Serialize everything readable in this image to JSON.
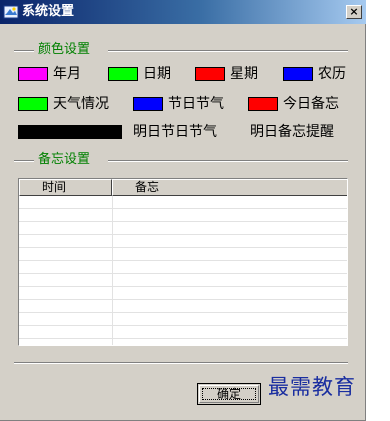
{
  "window": {
    "title": "系统设置",
    "close_glyph": "×"
  },
  "color_section": {
    "title": "颜色设置",
    "items": [
      {
        "label": "年月",
        "color": "#ff00ff"
      },
      {
        "label": "日期",
        "color": "#00ff00"
      },
      {
        "label": "星期",
        "color": "#ff0000"
      },
      {
        "label": "农历",
        "color": "#0000ff"
      },
      {
        "label": "天气情况",
        "color": "#00ff00"
      },
      {
        "label": "节日节气",
        "color": "#0000ff"
      },
      {
        "label": "今日备忘",
        "color": "#ff0000"
      },
      {
        "label": "明日节日节气",
        "color": "#000000"
      },
      {
        "label": "明日备忘提醒",
        "color": "#000000"
      }
    ]
  },
  "memo_section": {
    "title": "备忘设置",
    "columns": [
      "时间",
      "备忘"
    ],
    "rows": []
  },
  "buttons": {
    "ok": "确定"
  },
  "watermark": "最需教育"
}
